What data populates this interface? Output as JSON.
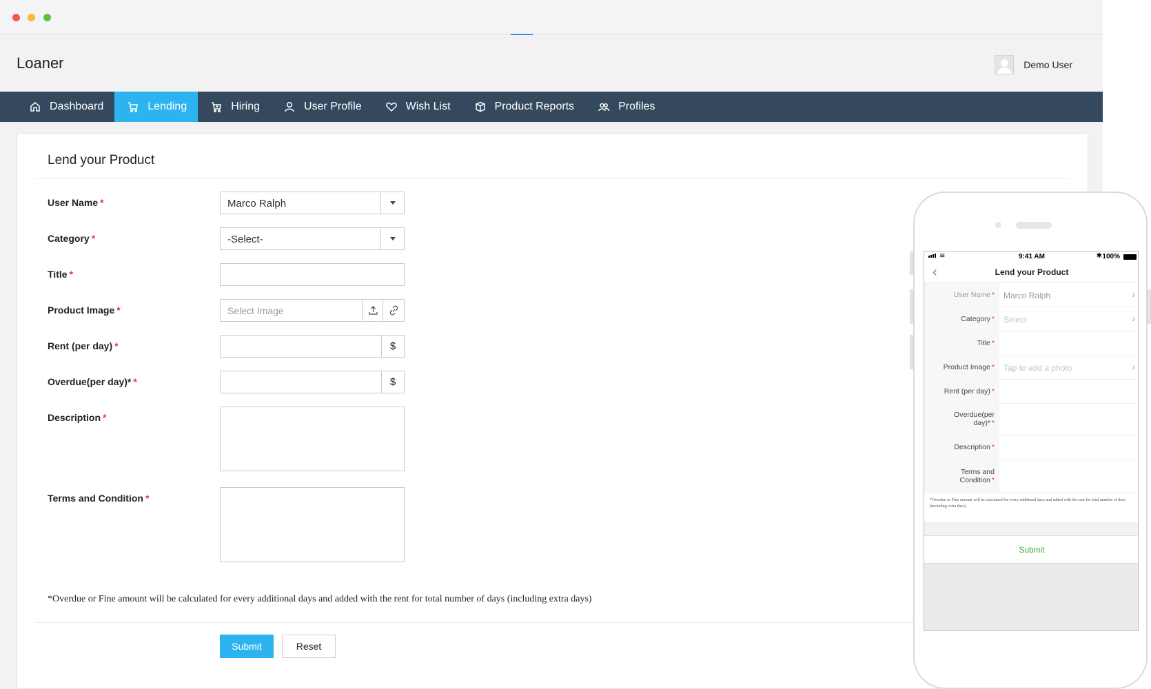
{
  "app": {
    "title": "Loaner",
    "user_name": "Demo User"
  },
  "nav": [
    {
      "label": "Dashboard",
      "icon": "home-icon",
      "active": false
    },
    {
      "label": "Lending",
      "icon": "cart-icon",
      "active": true
    },
    {
      "label": "Hiring",
      "icon": "cart-plus-icon",
      "active": false
    },
    {
      "label": "User Profile",
      "icon": "user-icon",
      "active": false
    },
    {
      "label": "Wish List",
      "icon": "heart-icon",
      "active": false
    },
    {
      "label": "Product Reports",
      "icon": "box-icon",
      "active": false
    },
    {
      "label": "Profiles",
      "icon": "users-icon",
      "active": false
    }
  ],
  "form": {
    "title": "Lend your Product",
    "required_mark": "*",
    "user_name": {
      "label": "User Name",
      "value": "Marco Ralph"
    },
    "category": {
      "label": "Category",
      "value": "-Select-"
    },
    "title_field": {
      "label": "Title",
      "value": ""
    },
    "product_image": {
      "label": "Product Image",
      "placeholder": "Select Image"
    },
    "rent": {
      "label": "Rent (per day)",
      "value": "",
      "addon": "$"
    },
    "overdue": {
      "label": "Overdue(per day)*",
      "value": "",
      "addon": "$"
    },
    "description": {
      "label": "Description",
      "value": ""
    },
    "terms": {
      "label": "Terms and Condition",
      "value": ""
    },
    "footnote": "*Overdue or Fine amount will be calculated for every additional days and added with the rent for total number of days (including extra days)",
    "submit_label": "Submit",
    "reset_label": "Reset"
  },
  "mobile": {
    "status": {
      "time": "9:41 AM",
      "battery": "100%"
    },
    "back_glyph": "‹",
    "title": "Lend your Product",
    "fields": {
      "user_name": {
        "label": "User Name",
        "value": "Marco Ralph"
      },
      "category": {
        "label": "Category",
        "placeholder": "Select"
      },
      "title_field": {
        "label": "Title"
      },
      "product_image": {
        "label": "Product Image",
        "placeholder": "Tap to add a photo"
      },
      "rent": {
        "label": "Rent (per day)"
      },
      "overdue": {
        "label_line1": "Overdue(per",
        "label_line2": "day)*"
      },
      "description": {
        "label": "Description"
      },
      "terms": {
        "label_line1": "Terms and",
        "label_line2": "Condition"
      }
    },
    "footnote": "*Overdue or Fine amount will be calculated for every additional days and added with the rent for total number of days (including extra days)",
    "submit_label": "Submit"
  },
  "colors": {
    "nav_bg": "#34495e",
    "accent": "#2db3f0",
    "required": "#e53935",
    "mobile_accent": "#3aa935"
  }
}
